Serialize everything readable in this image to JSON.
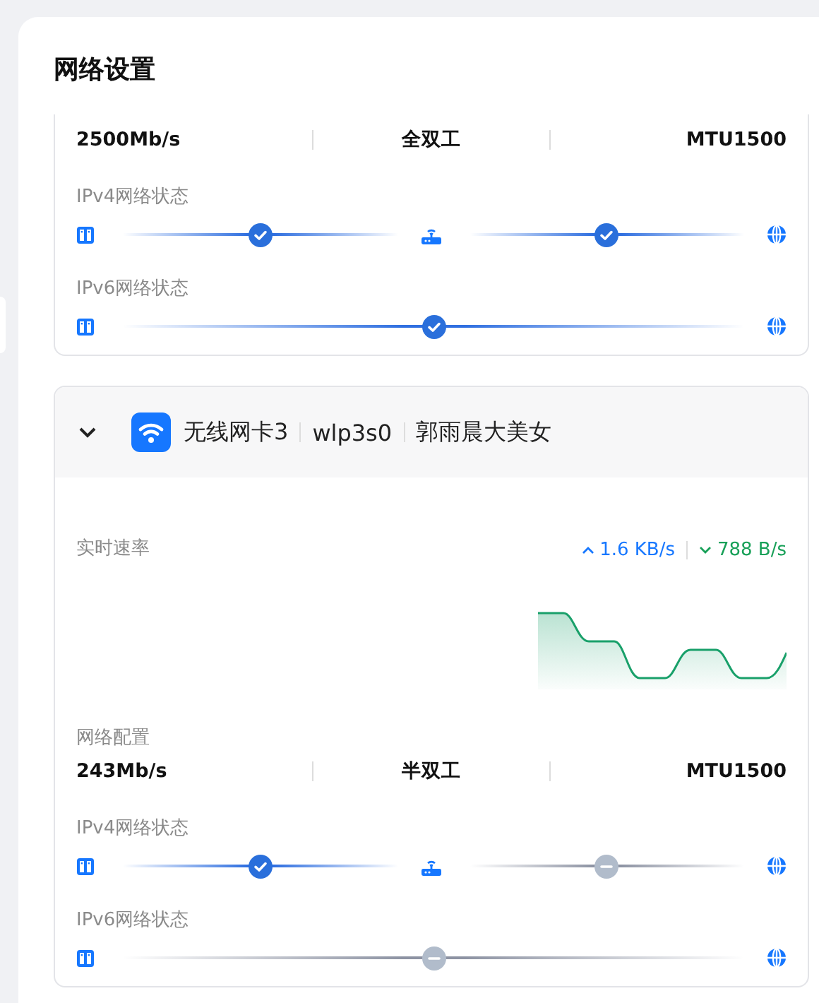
{
  "page": {
    "title": "网络设置"
  },
  "adapters": [
    {
      "config": {
        "speed": "2500Mb/s",
        "duplex": "全双工",
        "mtu": "MTU1500"
      },
      "status_rows": [
        {
          "label": "IPv4网络状态",
          "segments": [
            {
              "connected": true
            },
            {
              "connected": true
            }
          ]
        },
        {
          "label": "IPv6网络状态",
          "segments": [
            {
              "connected": true
            }
          ]
        }
      ]
    },
    {
      "header": {
        "expanded": true,
        "name": "无线网卡3",
        "interface": "wlp3s0",
        "ssid": "郭雨晨大美女"
      },
      "rate": {
        "label": "实时速率",
        "upload": "1.6 KB/s",
        "download": "788 B/s"
      },
      "config_label": "网络配置",
      "config": {
        "speed": "243Mb/s",
        "duplex": "半双工",
        "mtu": "MTU1500"
      },
      "status_rows": [
        {
          "label": "IPv4网络状态",
          "segments": [
            {
              "connected": true
            },
            {
              "connected": false
            }
          ]
        },
        {
          "label": "IPv6网络状态",
          "segments": [
            {
              "connected": false
            }
          ]
        }
      ]
    }
  ]
}
